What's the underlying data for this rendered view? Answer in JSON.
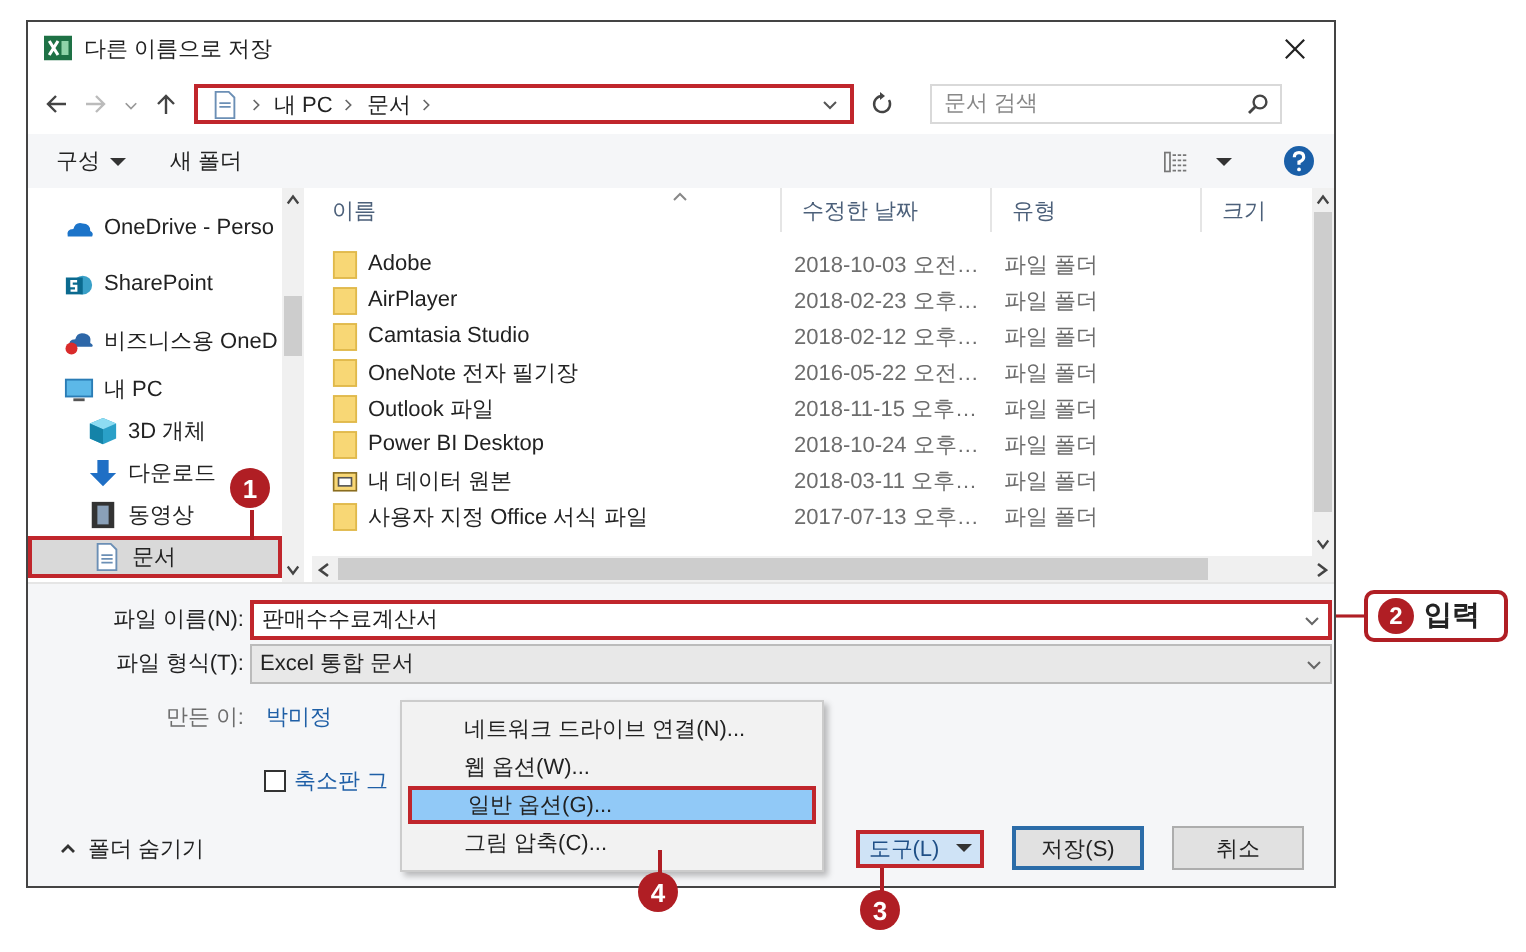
{
  "window": {
    "title": "다른 이름으로 저장"
  },
  "nav": {
    "breadcrumb": [
      "내 PC",
      "문서"
    ],
    "highlighted": true,
    "search": {
      "placeholder": "문서 검색"
    }
  },
  "toolbar": {
    "organize": "구성",
    "new_folder": "새 폴더"
  },
  "sidebar": {
    "items": [
      {
        "label": "OneDrive - Perso",
        "kind": "cloud",
        "selected": false,
        "highlighted": false
      },
      {
        "label": "SharePoint",
        "kind": "sharepoint",
        "selected": false,
        "highlighted": false
      },
      {
        "label": "비즈니스용 OneD",
        "kind": "cloud-error",
        "selected": false,
        "highlighted": false
      },
      {
        "label": "내 PC",
        "kind": "pc",
        "selected": false,
        "highlighted": false,
        "children": [
          {
            "label": "3D 개체",
            "kind": "cube",
            "selected": false,
            "highlighted": false
          },
          {
            "label": "다운로드",
            "kind": "download",
            "selected": false,
            "highlighted": false
          },
          {
            "label": "동영상",
            "kind": "video",
            "selected": false,
            "highlighted": false
          },
          {
            "label": "문서",
            "kind": "document",
            "selected": true,
            "highlighted": true
          }
        ]
      }
    ]
  },
  "table": {
    "columns": [
      "이름",
      "수정한 날짜",
      "유형",
      "크기"
    ],
    "rows": [
      {
        "name": "Adobe",
        "kind": "folder",
        "date": "2018-10-03 오전…",
        "type": "파일 폴더"
      },
      {
        "name": "AirPlayer",
        "kind": "folder",
        "date": "2018-02-23 오후…",
        "type": "파일 폴더"
      },
      {
        "name": "Camtasia Studio",
        "kind": "folder",
        "date": "2018-02-12 오후…",
        "type": "파일 폴더"
      },
      {
        "name": "OneNote 전자 필기장",
        "kind": "folder",
        "date": "2016-05-22 오전…",
        "type": "파일 폴더"
      },
      {
        "name": "Outlook 파일",
        "kind": "folder",
        "date": "2018-11-15 오후…",
        "type": "파일 폴더"
      },
      {
        "name": "Power BI Desktop",
        "kind": "folder",
        "date": "2018-10-24 오후…",
        "type": "파일 폴더"
      },
      {
        "name": "내 데이터 원본",
        "kind": "data-folder",
        "date": "2018-03-11 오후…",
        "type": "파일 폴더"
      },
      {
        "name": "사용자 지정 Office 서식 파일",
        "kind": "folder",
        "date": "2017-07-13 오후…",
        "type": "파일 폴더"
      }
    ]
  },
  "form": {
    "filename": {
      "label": "파일 이름(N):",
      "value": "판매수수료계산서",
      "highlighted": true
    },
    "filetype": {
      "label": "파일 형식(T):",
      "value": "Excel 통합 문서"
    },
    "author": {
      "label": "만든 이:",
      "value": "박미정"
    },
    "thumbnail": {
      "label": "축소판 그",
      "checked": false
    }
  },
  "footer": {
    "hide_folders": "폴더 숨기기",
    "tools": {
      "label": "도구(L)",
      "highlighted": true
    },
    "save": "저장(S)",
    "cancel": "취소"
  },
  "menu": {
    "items": [
      {
        "label": "네트워크 드라이브 연결(N)...",
        "selected": false,
        "highlighted": false
      },
      {
        "label": "웹 옵션(W)...",
        "selected": false,
        "highlighted": false
      },
      {
        "label": "일반 옵션(G)...",
        "selected": true,
        "highlighted": true
      },
      {
        "label": "그림 압축(C)...",
        "selected": false,
        "highlighted": false
      }
    ]
  },
  "annotations": [
    {
      "number": "1"
    },
    {
      "number": "2",
      "label": "입력"
    },
    {
      "number": "3"
    },
    {
      "number": "4"
    }
  ]
}
